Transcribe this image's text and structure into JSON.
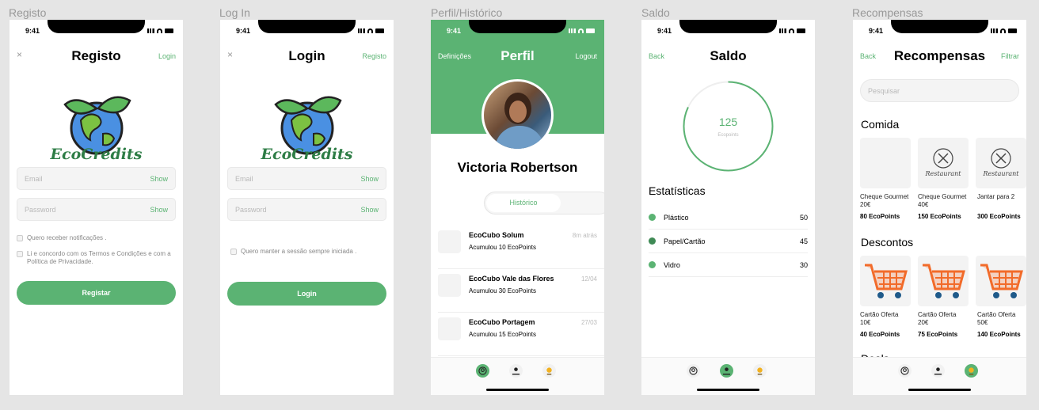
{
  "labels": {
    "registo": "Registo",
    "login": "Log In",
    "perfil": "Perfil/Histórico",
    "saldo": "Saldo",
    "recompensas": "Recompensas"
  },
  "status": {
    "time": "9:41"
  },
  "brand": "EcoCredits",
  "registo": {
    "title": "Registo",
    "close": "×",
    "link": "Login",
    "email": "Email",
    "password": "Password",
    "show": "Show",
    "notif": "Quero receber notificações .",
    "terms": "Li e concordo com os Termos e Condições e com a Política de Privacidade.",
    "button": "Registar"
  },
  "login": {
    "title": "Login",
    "close": "×",
    "link": "Registo",
    "email": "Email",
    "password": "Password",
    "show": "Show",
    "keep": "Quero manter a sessão sempre iniciada .",
    "button": "Login"
  },
  "perfil": {
    "title": "Perfil",
    "left": "Definições",
    "right": "Logout",
    "name": "Victoria Robertson",
    "tab": "Histórico",
    "history": [
      {
        "title": "EcoCubo Solum",
        "sub": "Acumulou 10 EcoPoints",
        "time": "8m atrás"
      },
      {
        "title": "EcoCubo Vale das Flores",
        "sub": "Acumulou 30 EcoPoints",
        "time": "12/04"
      },
      {
        "title": "EcoCubo Portagem",
        "sub": "Acumulou 15 EcoPoints",
        "time": "27/03"
      }
    ]
  },
  "saldo": {
    "title": "Saldo",
    "back": "Back",
    "value": "125",
    "unit": "Ecopoints",
    "progress": 0.82,
    "stats_title": "Estatísticas",
    "stats": [
      {
        "name": "Plástico",
        "value": "50"
      },
      {
        "name": "Papel/Cartão",
        "value": "45"
      },
      {
        "name": "Vidro",
        "value": "30"
      }
    ]
  },
  "recompensas": {
    "title": "Recompensas",
    "back": "Back",
    "filter": "Filtrar",
    "search": "Pesquisar",
    "sec1": "Comida",
    "sec2": "Descontos",
    "sec3": "Deals",
    "restaurant": "Restaurant",
    "comida": [
      {
        "name": "Cheque Gourmet 20€",
        "pts": "80 EcoPoints"
      },
      {
        "name": "Cheque Gourmet 40€",
        "pts": "150 EcoPoints"
      },
      {
        "name": "Jantar para 2",
        "pts": "300 EcoPoints"
      }
    ],
    "descontos": [
      {
        "name": "Cartão Oferta 10€",
        "pts": "40 EcoPoints"
      },
      {
        "name": "Cartão Oferta 20€",
        "pts": "75 EcoPoints"
      },
      {
        "name": "Cartão Oferta 50€",
        "pts": "140 EcoPoints"
      }
    ]
  },
  "colors": {
    "accent": "#5bb373",
    "cart": "#f26b2a"
  }
}
